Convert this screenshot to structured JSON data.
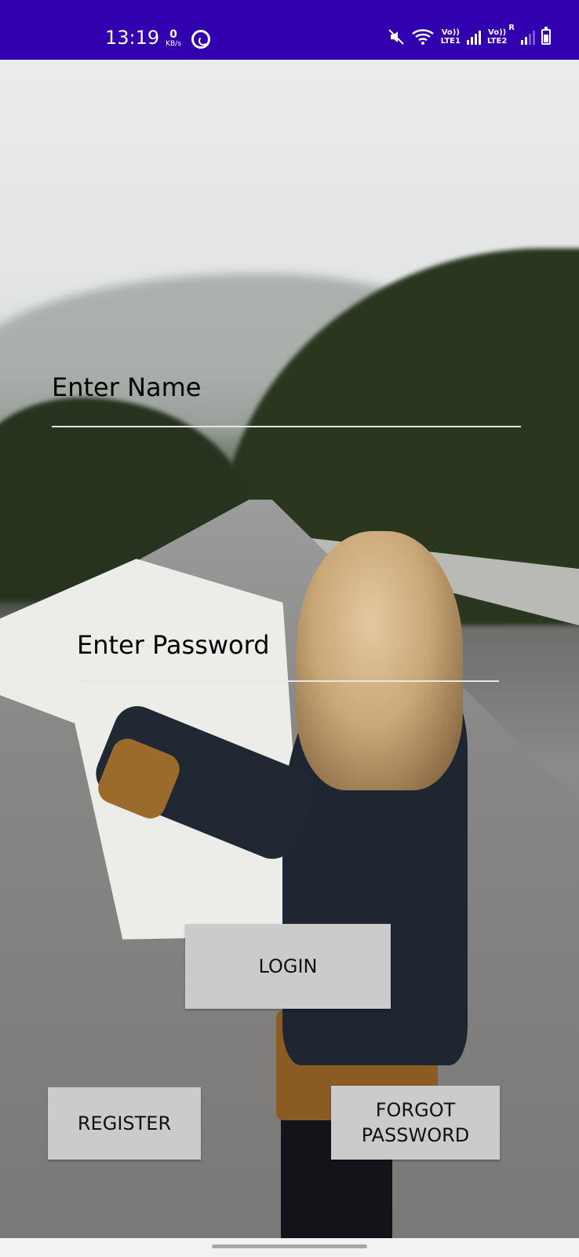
{
  "status_bar": {
    "time": "13:19",
    "data_speed_value": "0",
    "data_speed_unit": "KB/s",
    "sim1_label_top": "Vo))",
    "sim1_label_bottom": "LTE1",
    "sim2_label_top": "Vo))",
    "sim2_label_bottom": "LTE2",
    "roaming_label": "R",
    "icons": [
      "whatsapp-icon",
      "mute-icon",
      "wifi-icon",
      "signal-icon",
      "battery-icon"
    ],
    "background_color": "#3300b0"
  },
  "login_form": {
    "name_placeholder": "Enter Name",
    "password_placeholder": "Enter Password",
    "login_label": "LOGIN",
    "register_label": "REGISTER",
    "forgot_line1": "FORGOT",
    "forgot_line2": "PASSWORD"
  },
  "colors": {
    "button_bg": "#cbcbcb",
    "underline": "#e6e6e6"
  }
}
